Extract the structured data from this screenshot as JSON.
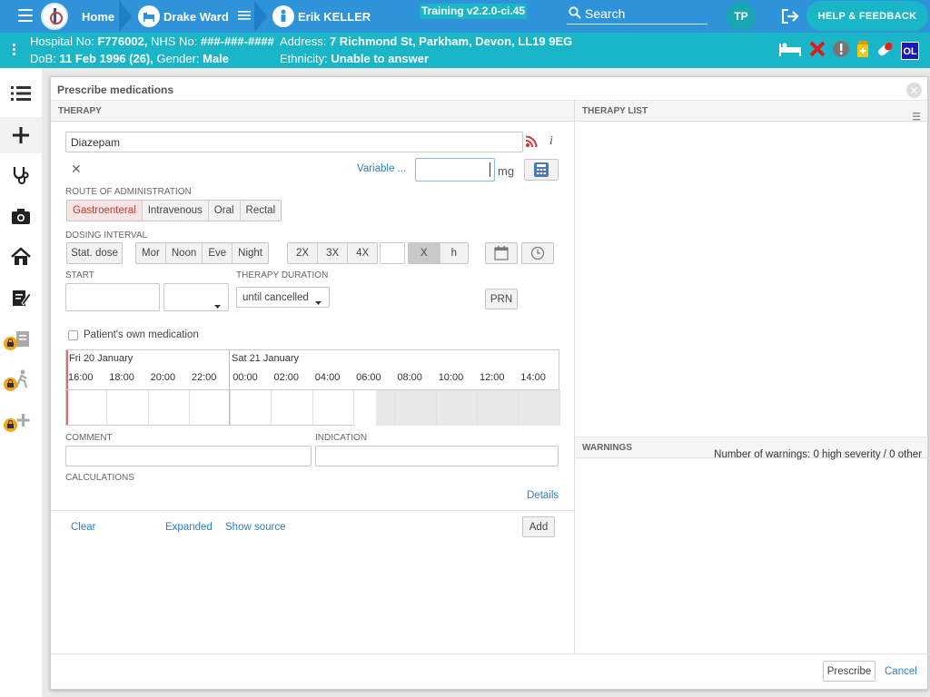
{
  "nav": {
    "home": "Home",
    "ward": "Drake Ward",
    "patient": "Erik KELLER",
    "version": "Training v2.2.0-ci.45",
    "search_placeholder": "Search",
    "user_initials": "TP",
    "help": "HELP & FEEDBACK"
  },
  "banner": {
    "hospital_label": "Hospital No:",
    "hospital_no": "F776002,",
    "nhs_label": "NHS No:",
    "nhs_no": "###-###-####",
    "dob_label": "DoB:",
    "dob": "11 Feb 1996 (26),",
    "gender_label": "Gender:",
    "gender": "Male",
    "address_label": "Address:",
    "address": "7 Richmond St, Parkham, Devon, LL19 9EG",
    "ethnicity_label": "Ethnicity:",
    "ethnicity": "Unable to answer",
    "badge": "OL"
  },
  "dialog": {
    "title": "Prescribe medications",
    "therapy_header": "THERAPY",
    "therapy_list_header": "THERAPY LIST",
    "warnings_header": "WARNINGS",
    "warnings_count": "Number of warnings: 0 high severity / 0 other",
    "drug_value": "Diazepam",
    "variable_link": "Variable ...",
    "dose_unit": "mg",
    "route_label": "ROUTE OF ADMINISTRATION",
    "routes": [
      "Gastroenteral",
      "Intravenous",
      "Oral",
      "Rectal"
    ],
    "dosing_label": "DOSING INTERVAL",
    "stat_dose": "Stat. dose",
    "times": [
      "Mor",
      "Noon",
      "Eve",
      "Night"
    ],
    "multipliers": [
      "2X",
      "3X",
      "4X"
    ],
    "x_label": "X",
    "h_label": "h",
    "start_label": "START",
    "duration_label": "THERAPY DURATION",
    "duration_value": "until cancelled",
    "prn": "PRN",
    "own_med": "Patient's own medication",
    "day1": "Fri 20 January",
    "day2": "Sat 21 January",
    "hours": [
      "16:00",
      "18:00",
      "20:00",
      "22:00",
      "00:00",
      "02:00",
      "04:00",
      "06:00",
      "08:00",
      "10:00",
      "12:00",
      "14:00"
    ],
    "comment_label": "COMMENT",
    "indication_label": "INDICATION",
    "calculations_label": "CALCULATIONS",
    "details": "Details",
    "clear": "Clear",
    "expanded": "Expanded",
    "show_source": "Show source",
    "add": "Add",
    "prescribe": "Prescribe",
    "cancel": "Cancel"
  },
  "colors": {
    "nav_bg": "#2e93d8",
    "banner_bg": "#1ab5c6",
    "accent_red": "#d23b3b",
    "link": "#2a7fc4"
  }
}
